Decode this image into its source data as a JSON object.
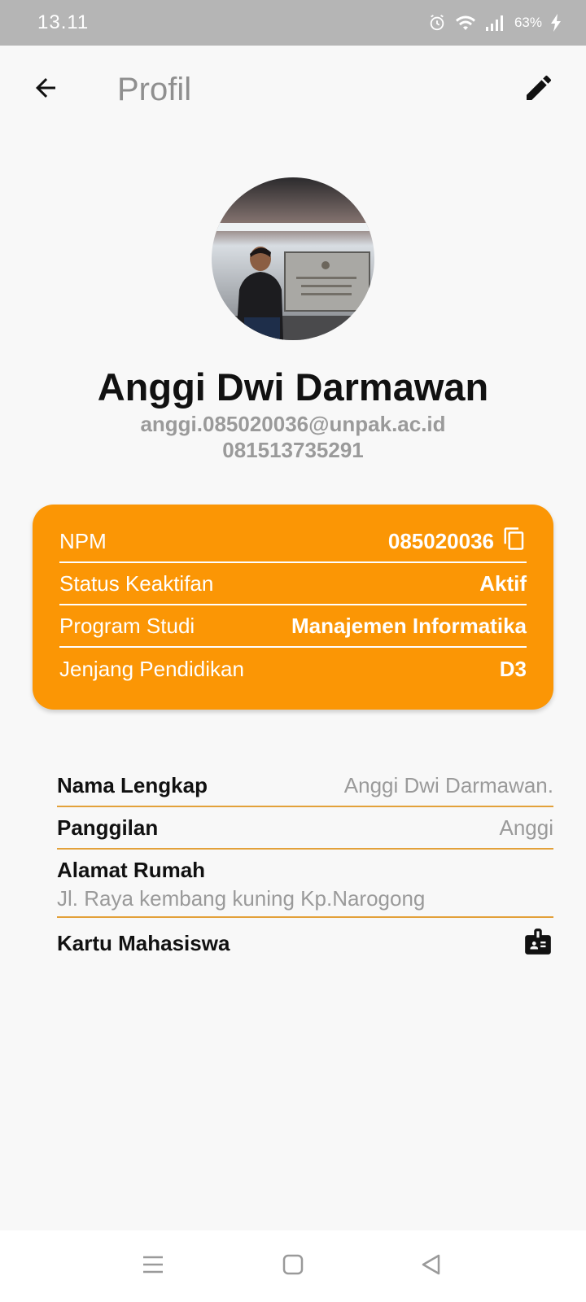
{
  "status_bar": {
    "time": "13.11",
    "battery": "63%",
    "icons": [
      "alarm-icon",
      "wifi-icon",
      "signal-icon",
      "charging-icon"
    ]
  },
  "app_bar": {
    "title": "Profil",
    "back_icon": "arrow-back-icon",
    "edit_icon": "pencil-icon"
  },
  "profile": {
    "name": "Anggi Dwi Darmawan",
    "email": "anggi.085020036@unpak.ac.id",
    "phone": "081513735291"
  },
  "card": {
    "accent": "#fb9605",
    "rows": [
      {
        "label": "NPM",
        "value": "085020036"
      },
      {
        "label": "Status Keaktifan",
        "value": "Aktif"
      },
      {
        "label": "Program Studi",
        "value": "Manajemen Informatika"
      },
      {
        "label": "Jenjang Pendidikan",
        "value": "D3"
      }
    ]
  },
  "details": {
    "full_name_label": "Nama Lengkap",
    "full_name_value": "Anggi Dwi Darmawan.",
    "nickname_label": "Panggilan",
    "nickname_value": "Anggi",
    "address_label": "Alamat Rumah",
    "address_value": "Jl. Raya kembang kuning Kp.Narogong",
    "student_card_label": "Kartu Mahasiswa",
    "divider_color": "#e3a13a"
  },
  "nav_bar": {
    "icons": [
      "menu-icon",
      "home-icon",
      "back-triangle-icon"
    ]
  }
}
